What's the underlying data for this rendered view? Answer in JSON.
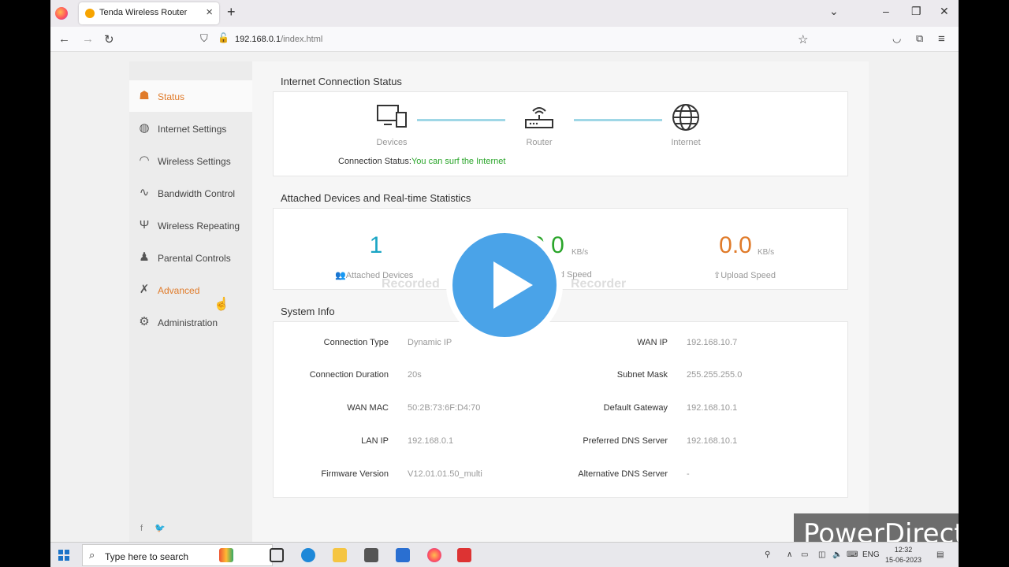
{
  "browser": {
    "tab_title": "Tenda Wireless Router",
    "url_host": "192.168.0.1",
    "url_path": "/index.html"
  },
  "sidebar": {
    "items": [
      {
        "label": "Status",
        "icon": "status-icon"
      },
      {
        "label": "Internet Settings",
        "icon": "globe-icon"
      },
      {
        "label": "Wireless Settings",
        "icon": "wifi-icon"
      },
      {
        "label": "Bandwidth Control",
        "icon": "bandwidth-icon"
      },
      {
        "label": "Wireless Repeating",
        "icon": "antenna-icon"
      },
      {
        "label": "Parental Controls",
        "icon": "parental-icon"
      },
      {
        "label": "Advanced",
        "icon": "tools-icon"
      },
      {
        "label": "Administration",
        "icon": "gears-icon"
      }
    ],
    "social": "f 🐦"
  },
  "internet_status": {
    "title": "Internet Connection Status",
    "devices_label": "Devices",
    "router_label": "Router",
    "internet_label": "Internet",
    "status_prefix": "Connection Status:",
    "status_value": "You can surf the Internet"
  },
  "stats": {
    "title": "Attached Devices and Real-time Statistics",
    "attached_count": "1",
    "attached_label": "Attached Devices",
    "download_value": "0.0",
    "download_unit": "KB/s",
    "download_label": "Download Speed",
    "upload_value": "0.0",
    "upload_unit": "KB/s",
    "upload_label": "Upload Speed"
  },
  "system_info": {
    "title": "System Info",
    "left": [
      {
        "label": "Connection Type",
        "value": "Dynamic IP"
      },
      {
        "label": "Connection Duration",
        "value": "20s"
      },
      {
        "label": "WAN MAC",
        "value": "50:2B:73:6F:D4:70"
      },
      {
        "label": "LAN IP",
        "value": "192.168.0.1"
      },
      {
        "label": "Firmware Version",
        "value": "V12.01.01.50_multi"
      }
    ],
    "right": [
      {
        "label": "WAN IP",
        "value": "192.168.10.7"
      },
      {
        "label": "Subnet Mask",
        "value": "255.255.255.0"
      },
      {
        "label": "Default Gateway",
        "value": "192.168.10.1"
      },
      {
        "label": "Preferred DNS Server",
        "value": "192.168.10.1"
      },
      {
        "label": "Alternative DNS Server",
        "value": "-"
      }
    ]
  },
  "overlay": {
    "watermark_left": "Recorded",
    "watermark_right": "Recorder",
    "brand": "PowerDirector"
  },
  "taskbar": {
    "search_placeholder": "Type here to search",
    "language": "ENG",
    "time": "12:32",
    "date": "15-06-2023"
  },
  "colors": {
    "accent": "#e07b2a",
    "ok_green": "#2aa52a",
    "count_teal": "#1aa5c4",
    "download_green": "#2aa52a",
    "upload_orange": "#e07b2a"
  }
}
